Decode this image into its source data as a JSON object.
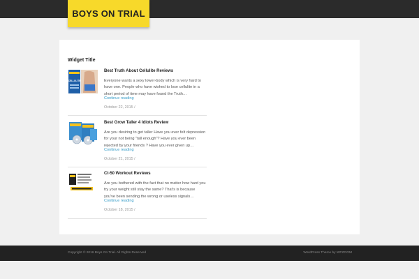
{
  "site": {
    "title": "BOYS ON TRIAL"
  },
  "widget": {
    "title": "Widget Title"
  },
  "posts": [
    {
      "title": "Best Truth About Cellulite Reviews",
      "excerpt": "Everyone wants a sexy lower-body which is very hard to have one. People who have wished to lose cellulite in a short period of time may have found the Truth…",
      "more": "Continue reading",
      "date": "October 22, 2015 /",
      "thumb_text": "CELLULITE"
    },
    {
      "title": "Best Grow Taller 4 Idiots Review",
      "excerpt": "Are you desiring to get taller     Have you ever felt depression for your not being \"tall enough\"? Have you ever been rejected by your friends ? Have you ever given up…",
      "more": "Continue reading",
      "date": "October 21, 2015 /"
    },
    {
      "title": "Ct-50 Workout Reviews",
      "excerpt": "Are you bothered with the fact that no matter how hard you try your weight still stay the same? That's is because you've been sending the wrong or useless signals…",
      "more": "Continue reading",
      "date": "October 18, 2015 /"
    }
  ],
  "footer": {
    "copyright": "Copyright © 2016 Boys On Trial. All Rights Reserved",
    "theme_credit": "WordPress Theme by WPZOOM"
  },
  "colors": {
    "topbar": "#2b2b2b",
    "logo_bg": "#f7d92a",
    "link": "#3a9ec9",
    "footer": "#222222"
  }
}
